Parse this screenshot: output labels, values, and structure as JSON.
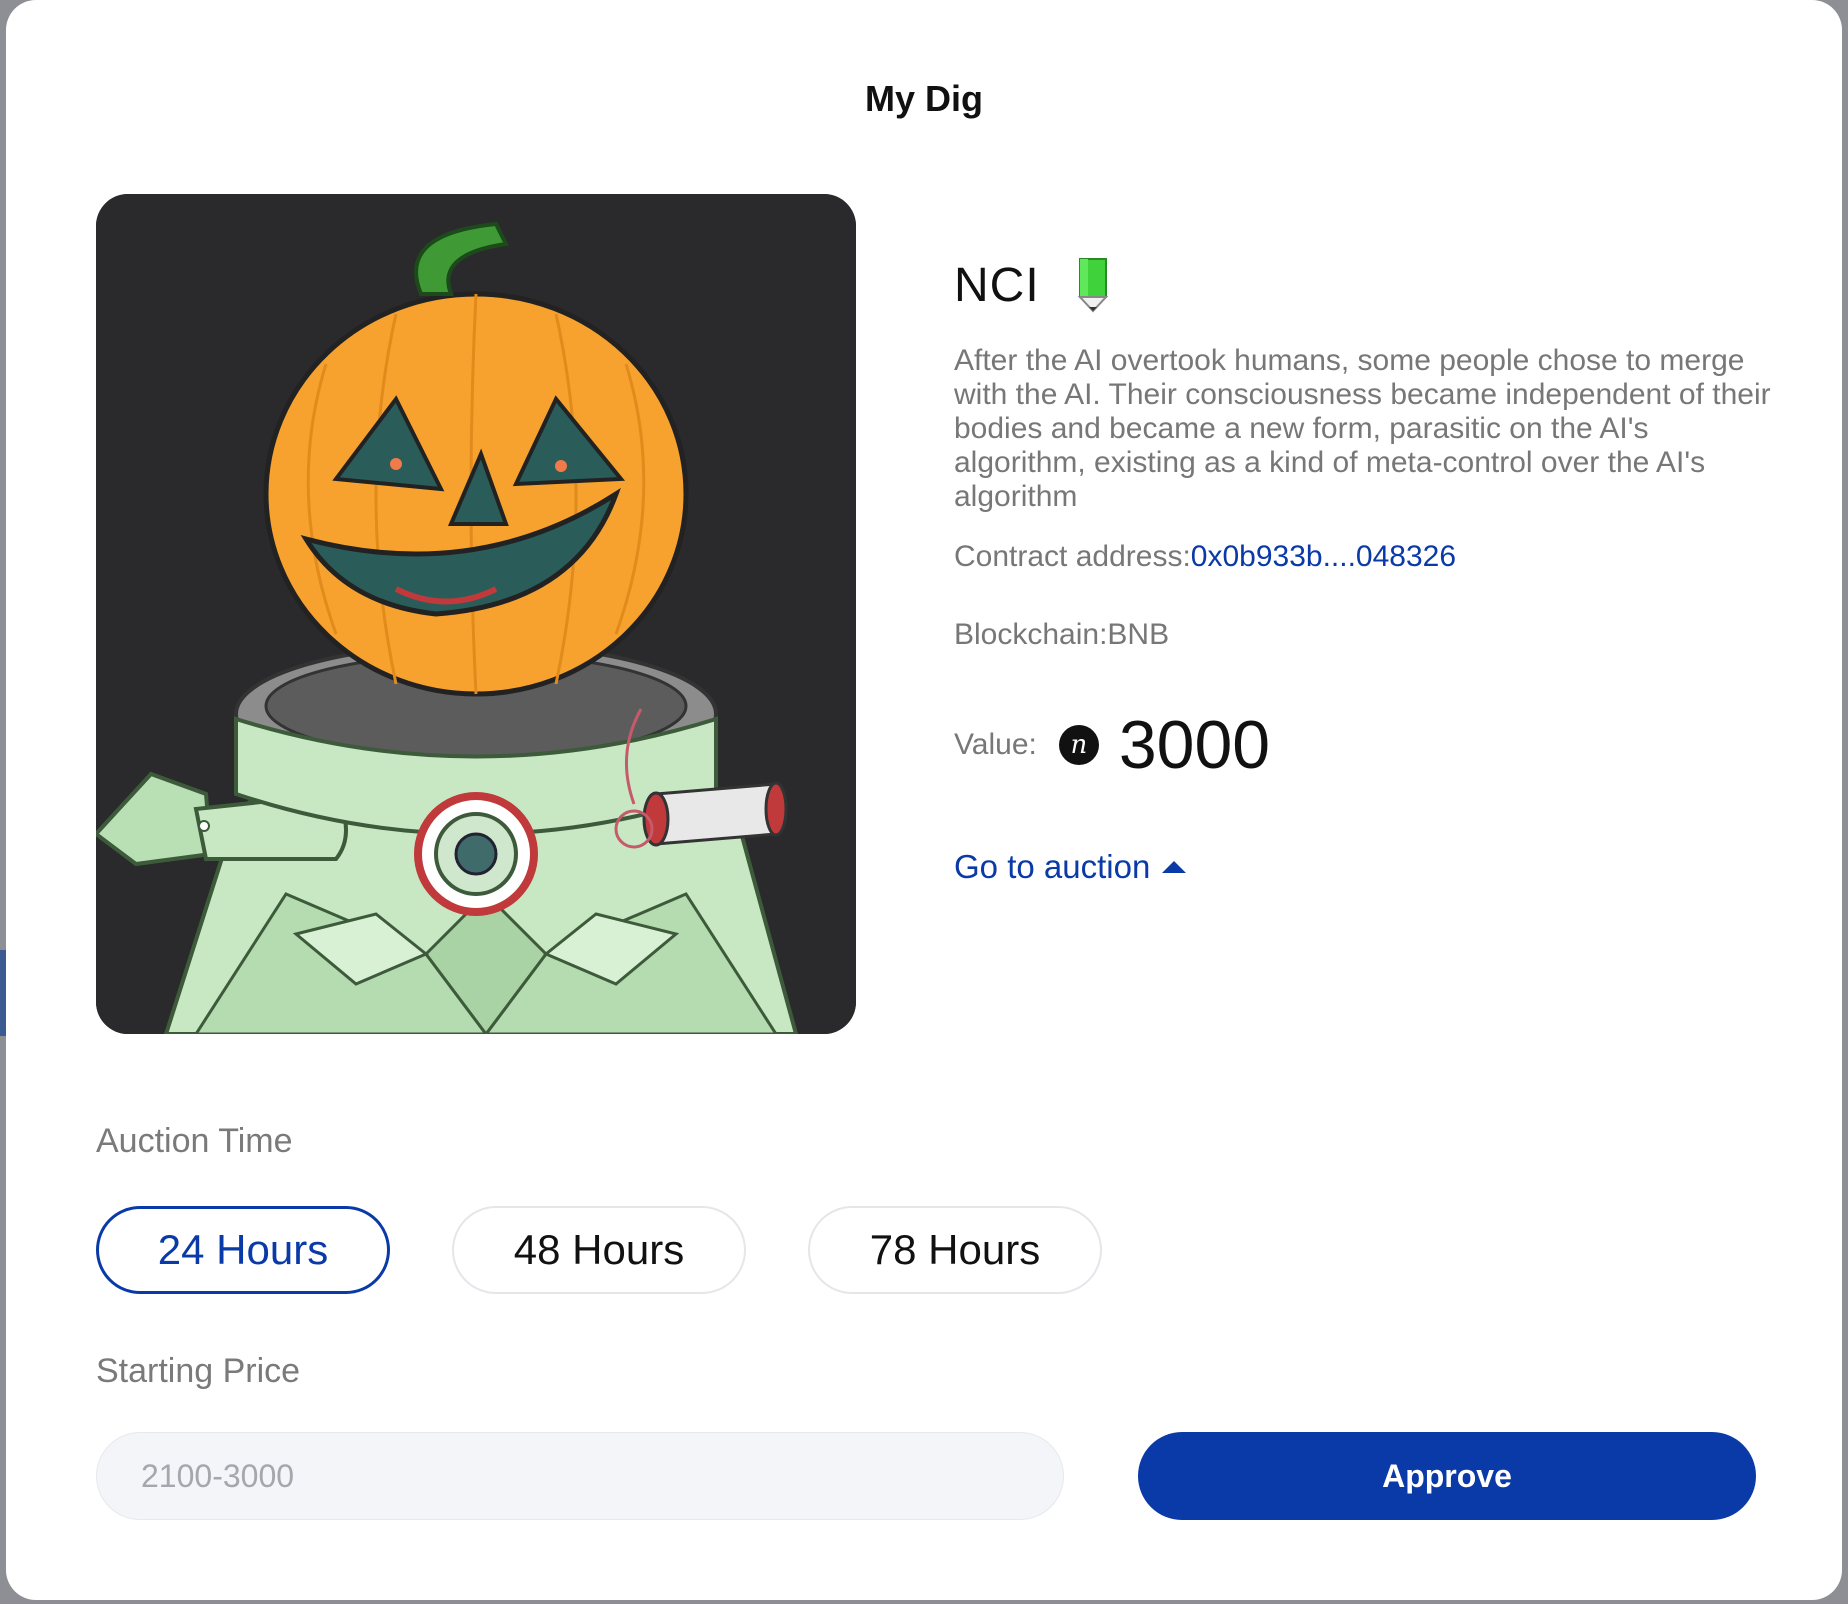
{
  "modal": {
    "title": "My Dig"
  },
  "nft": {
    "name": "NCI",
    "description": "After the AI overtook humans, some people chose to merge with the AI. Their consciousness became independent of their bodies and became a new form, parasitic on the AI's algorithm, existing as a kind of meta-control over the AI's algorithm",
    "contract_label": "Contract address:",
    "contract_address": "0x0b933b....048326",
    "blockchain_text": "Blockchain:BNB",
    "value_label": "Value:",
    "coin_symbol": "n",
    "value_amount": "3000",
    "goto_auction_label": "Go to auction",
    "image_alt": "pumpkin-head astronaut artwork",
    "pencil_icon": "green-pencil-icon",
    "caret_icon": "caret-up-icon"
  },
  "auction_time": {
    "label": "Auction Time",
    "options": [
      "24 Hours",
      "48 Hours",
      "78 Hours"
    ],
    "selected": "24 Hours"
  },
  "starting_price": {
    "label": "Starting Price",
    "placeholder": "2100-3000",
    "value": ""
  },
  "actions": {
    "approve_label": "Approve"
  },
  "colors": {
    "accent": "#0a3aa8",
    "pumpkin": "#f7a22e",
    "suit": "#c7e8c3",
    "background": "#2a2a2c"
  }
}
